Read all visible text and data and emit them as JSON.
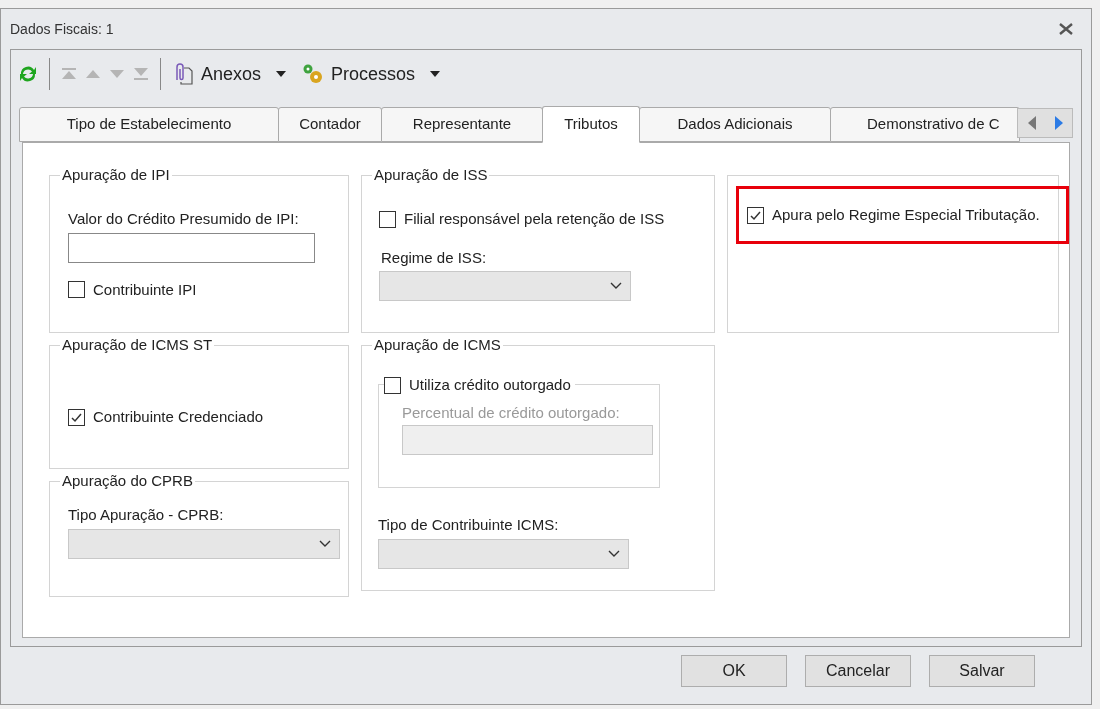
{
  "window": {
    "title": "Dados Fiscais: 1"
  },
  "toolbar": {
    "buttons": [
      {
        "label": "Anexos"
      },
      {
        "label": "Processos"
      }
    ]
  },
  "tabs": [
    {
      "label": "Tipo de Estabelecimento",
      "selected": false
    },
    {
      "label": "Contador",
      "selected": false
    },
    {
      "label": "Representante",
      "selected": false
    },
    {
      "label": "Tributos",
      "selected": true
    },
    {
      "label": "Dados Adicionais",
      "selected": false
    },
    {
      "label": "Demonstrativo de C",
      "selected": false
    }
  ],
  "groups": {
    "ipi": {
      "title": "Apuração de IPI",
      "field_label": "Valor do Crédito Presumido de IPI:",
      "checkbox": {
        "label": "Contribuinte IPI",
        "checked": false
      }
    },
    "icms_st": {
      "title": "Apuração de ICMS ST",
      "checkbox": {
        "label": "Contribuinte Credenciado",
        "checked": true
      }
    },
    "cprb": {
      "title": "Apuração do CPRB",
      "select_label": "Tipo Apuração - CPRB:"
    },
    "iss": {
      "title": "Apuração de ISS",
      "checkbox": {
        "label": "Filial responsável pela retenção de ISS",
        "checked": false
      },
      "select_label": "Regime de ISS:"
    },
    "icms": {
      "title": "Apuração de ICMS",
      "sub_checkbox": {
        "label": "Utiliza crédito outorgado",
        "checked": false
      },
      "sub_field_label": "Percentual de crédito outorgado:",
      "select_label": "Tipo de Contribuinte ICMS:"
    },
    "regime": {
      "checkbox": {
        "label": "Apura pelo Regime Especial Tributação.",
        "checked": true,
        "highlighted": true
      }
    }
  },
  "buttons": [
    "OK",
    "Cancelar",
    "Salvar"
  ]
}
